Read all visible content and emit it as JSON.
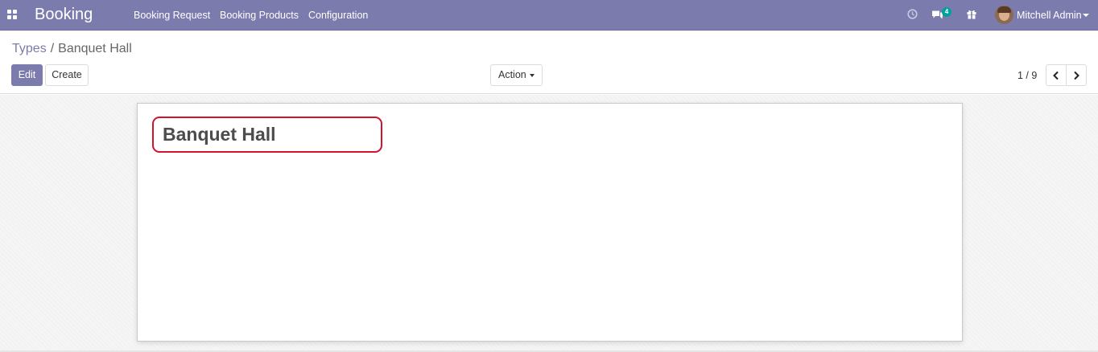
{
  "navbar": {
    "app_name": "Booking",
    "menu": [
      "Booking Request",
      "Booking Products",
      "Configuration"
    ],
    "messages_badge": "4",
    "user_name": "Mitchell Admin",
    "bg_color": "#7c7bad",
    "icons": [
      "apps-icon",
      "activity-clock-icon",
      "chat-icon",
      "gift-icon",
      "avatar"
    ]
  },
  "control_panel": {
    "breadcrumb_parent": "Types",
    "breadcrumb_separator": "/",
    "breadcrumb_current": "Banquet Hall",
    "edit_label": "Edit",
    "create_label": "Create",
    "action_label": "Action",
    "pager": "1 / 9"
  },
  "form": {
    "title": "Banquet Hall",
    "highlight_color": "#d0142b"
  }
}
